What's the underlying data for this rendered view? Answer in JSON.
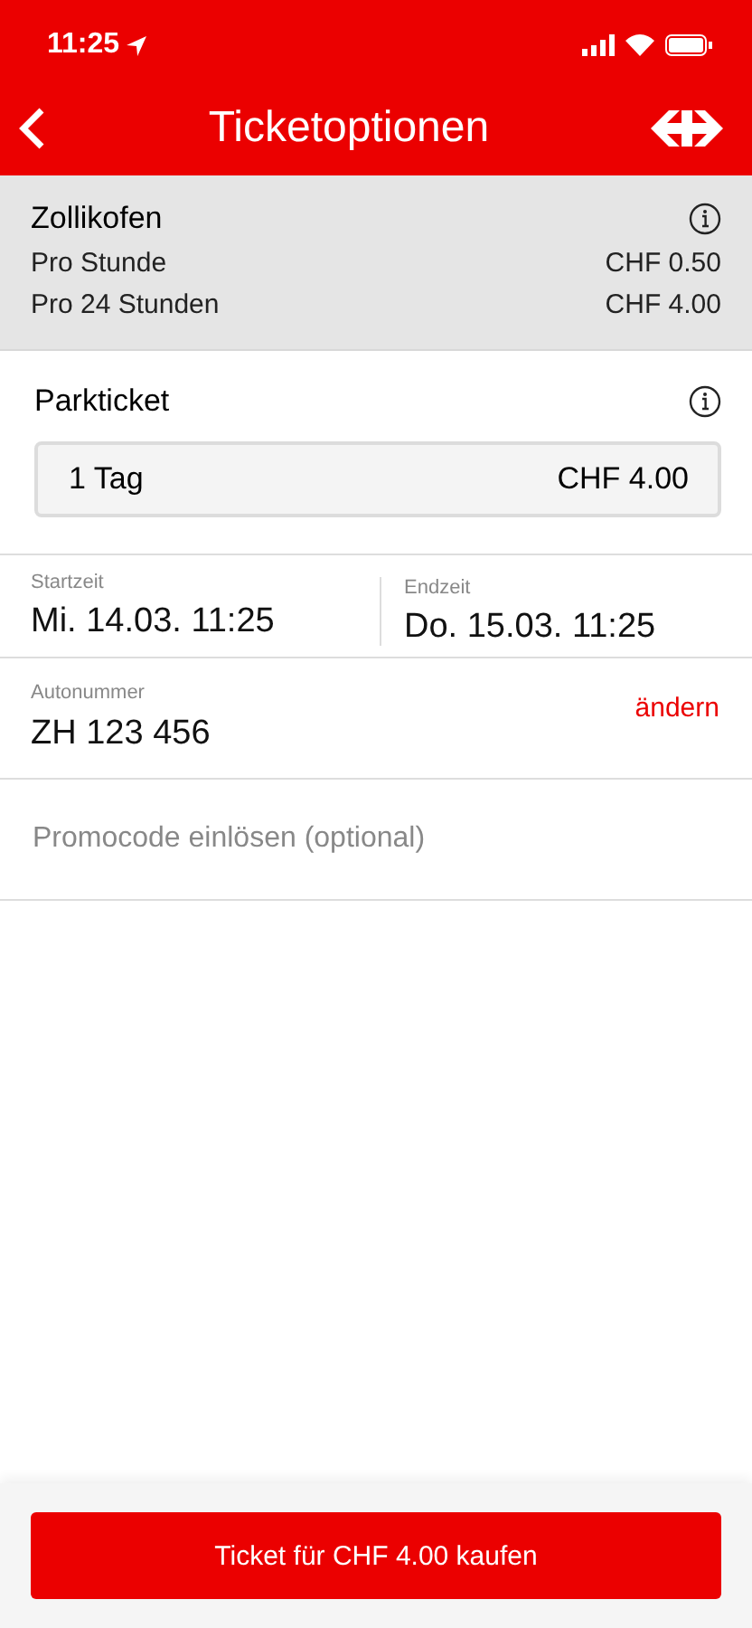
{
  "status_bar": {
    "time": "11:25"
  },
  "nav": {
    "title": "Ticketoptionen"
  },
  "location": {
    "name": "Zollikofen",
    "rates": [
      {
        "label": "Pro Stunde",
        "price": "CHF 0.50"
      },
      {
        "label": "Pro 24 Stunden",
        "price": "CHF 4.00"
      }
    ]
  },
  "ticket": {
    "title": "Parkticket",
    "option": "1 Tag",
    "price": "CHF 4.00"
  },
  "times": [
    {
      "label": "Startzeit",
      "value": "Mi. 14.03. 11:25"
    },
    {
      "label": "Endzeit",
      "value": "Do. 15.03. 11:25"
    }
  ],
  "plate": {
    "label": "Autonummer",
    "value": "ZH 123 456",
    "action": "ändern"
  },
  "promo": {
    "placeholder": "Promocode einlösen (optional)"
  },
  "buy_button": "Ticket für CHF 4.00 kaufen"
}
